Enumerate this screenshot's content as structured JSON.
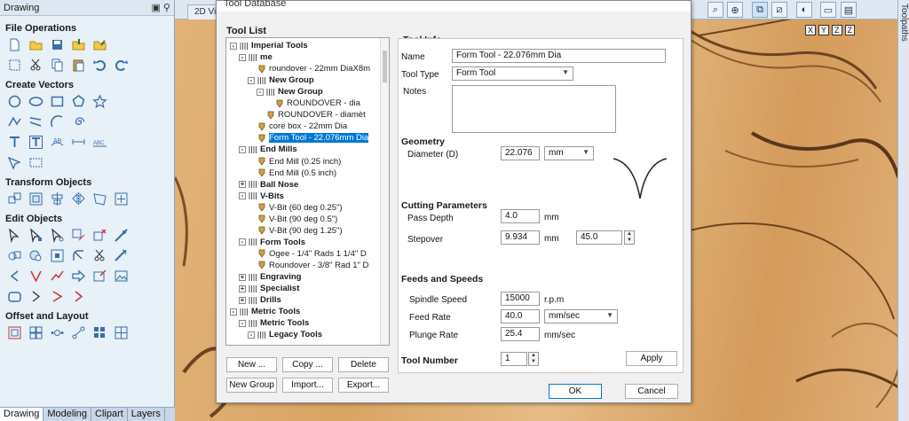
{
  "left_panel": {
    "title": "Drawing",
    "sections": [
      {
        "title": "File Operations"
      },
      {
        "title": "Create Vectors"
      },
      {
        "title": "Transform Objects"
      },
      {
        "title": "Edit Objects"
      },
      {
        "title": "Offset and Layout"
      }
    ],
    "bottom_tabs": [
      "Drawing",
      "Modeling",
      "Clipart",
      "Layers"
    ]
  },
  "view_tab": "2D Vi",
  "right_tab": "Toolpaths",
  "axes_labels": [
    "X",
    "Y",
    "Z",
    "Z"
  ],
  "dialog": {
    "title": "Tool Database",
    "tool_list_label": "Tool List",
    "tree": [
      {
        "label": "Imperial Tools",
        "bold": true
      },
      {
        "label": "me",
        "bold": true
      },
      {
        "label": "roundover - 22mm DiaX8m"
      },
      {
        "label": "New Group",
        "bold": true
      },
      {
        "label": "New Group",
        "bold": true
      },
      {
        "label": "ROUNDOVER - dia"
      },
      {
        "label": "ROUNDOVER - diamèt"
      },
      {
        "label": "core box - 22mm Dia"
      },
      {
        "label": "Form Tool - 22.076mm Dia",
        "selected": true
      },
      {
        "label": "End Mills",
        "bold": true
      },
      {
        "label": "End Mill (0.25 inch)"
      },
      {
        "label": "End Mill (0.5 inch)"
      },
      {
        "label": "Ball Nose",
        "bold": true
      },
      {
        "label": "V-Bits",
        "bold": true
      },
      {
        "label": "V-Bit (60 deg 0.25\")"
      },
      {
        "label": "V-Bit (90 deg 0.5\")"
      },
      {
        "label": "V-Bit (90 deg 1.25\")"
      },
      {
        "label": "Form Tools",
        "bold": true
      },
      {
        "label": "Ogee - 1/4\" Rads 1 1/4\" D"
      },
      {
        "label": "Roundover - 3/8\" Rad 1\" D"
      },
      {
        "label": "Engraving",
        "bold": true
      },
      {
        "label": "Specialist",
        "bold": true
      },
      {
        "label": "Drills",
        "bold": true
      },
      {
        "label": "Metric Tools",
        "bold": true
      },
      {
        "label": "Metric Tools",
        "bold": true
      },
      {
        "label": "Legacy Tools",
        "bold": true
      }
    ],
    "buttons": {
      "new": "New ...",
      "copy": "Copy ...",
      "delete": "Delete",
      "new_group": "New Group",
      "import": "Import...",
      "export": "Export...",
      "ok": "OK",
      "cancel": "Cancel",
      "apply": "Apply"
    },
    "tool_info": {
      "header": "Tool Info",
      "name_label": "Name",
      "name_value": "Form Tool - 22.076mm Dia",
      "type_label": "Tool Type",
      "type_value": "Form Tool",
      "notes_label": "Notes"
    },
    "geometry": {
      "header": "Geometry",
      "diameter_label": "Diameter (D)",
      "diameter_value": "22.076",
      "diameter_unit": "mm"
    },
    "cutting": {
      "header": "Cutting Parameters",
      "pass_depth_label": "Pass Depth",
      "pass_depth_value": "4.0",
      "pass_depth_unit": "mm",
      "stepover_label": "Stepover",
      "stepover_value": "9.934",
      "stepover_unit": "mm",
      "stepover_percent": "45.0"
    },
    "feeds": {
      "header": "Feeds and Speeds",
      "spindle_label": "Spindle Speed",
      "spindle_value": "15000",
      "spindle_unit": "r.p.m",
      "feed_label": "Feed Rate",
      "feed_value": "40.0",
      "feed_unit": "mm/sec",
      "plunge_label": "Plunge Rate",
      "plunge_value": "25.4",
      "plunge_unit": "mm/sec"
    },
    "tool_number": {
      "label": "Tool Number",
      "value": "1"
    }
  }
}
